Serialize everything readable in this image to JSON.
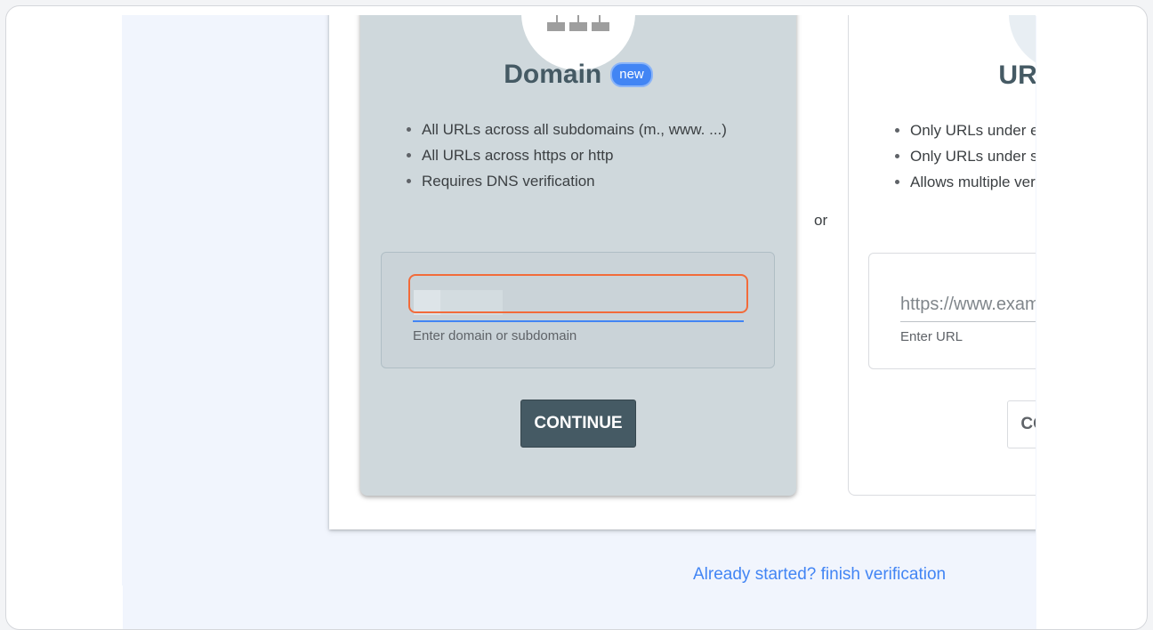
{
  "domain_card": {
    "title": "Domain",
    "badge": "new",
    "bullets": [
      "All URLs across all subdomains (m., www. ...)",
      "All URLs across https or http",
      "Requires DNS verification"
    ],
    "input_value": "",
    "helper": "Enter domain or subdomain",
    "button": "CONTINUE"
  },
  "separator": "or",
  "url_card": {
    "title": "URL prefix",
    "bullets": [
      "Only URLs under entered address",
      "Only URLs under specified protocol",
      "Allows multiple verification methods"
    ],
    "input_placeholder": "https://www.example.com",
    "helper": "Enter URL",
    "button": "CONTINUE"
  },
  "footer_link": "Already started? finish verification",
  "colors": {
    "domain_card_bg": "#cfd8dc",
    "primary_button": "#455a64",
    "badge": "#4285f4",
    "highlight": "#f26b3a",
    "link": "#4285f4"
  }
}
